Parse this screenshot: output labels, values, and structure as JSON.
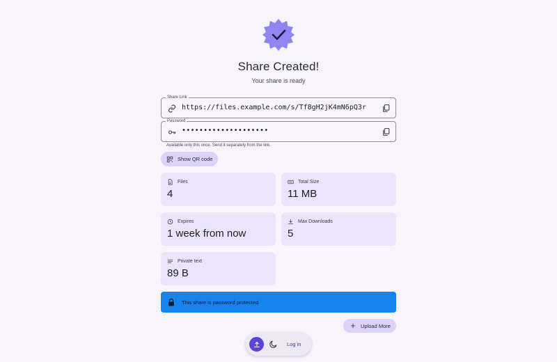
{
  "header": {
    "title": "Share Created!",
    "subtitle": "Your share is ready"
  },
  "share_link": {
    "label": "Share Link",
    "value": "https://files.example.com/s/Tf8gH2jK4mN6pQ3r",
    "icon": "link-icon"
  },
  "password": {
    "label": "Password",
    "value": "••••••••••••••••••••",
    "icon": "key-icon"
  },
  "hint": "Available only this once. Send it separately from the link.",
  "qr_button": {
    "label": "Show QR code",
    "icon": "qr-code-icon"
  },
  "stats": {
    "files": {
      "label": "Files",
      "value": "4",
      "icon": "file-icon"
    },
    "total_size": {
      "label": "Total Size",
      "value": "11 MB",
      "icon": "storage-icon"
    },
    "expires": {
      "label": "Expires",
      "value": "1 week from now",
      "icon": "clock-icon"
    },
    "max_downloads": {
      "label": "Max Downloads",
      "value": "5",
      "icon": "download-icon"
    },
    "private_text": {
      "label": "Private text",
      "value": "89 B",
      "icon": "text-icon"
    }
  },
  "alert": {
    "text": "This share is password protected",
    "icon": "lock-icon"
  },
  "upload_more": {
    "label": "Upload More",
    "icon": "plus-icon"
  },
  "dock": {
    "login_label": "Log in"
  },
  "colors": {
    "background": "#f8f4fc",
    "accent": "#5b45d4",
    "badge": "#8f86f2",
    "card": "#ebe5fb",
    "tonal_button": "#dcd3fb",
    "alert": "#1683ee"
  }
}
